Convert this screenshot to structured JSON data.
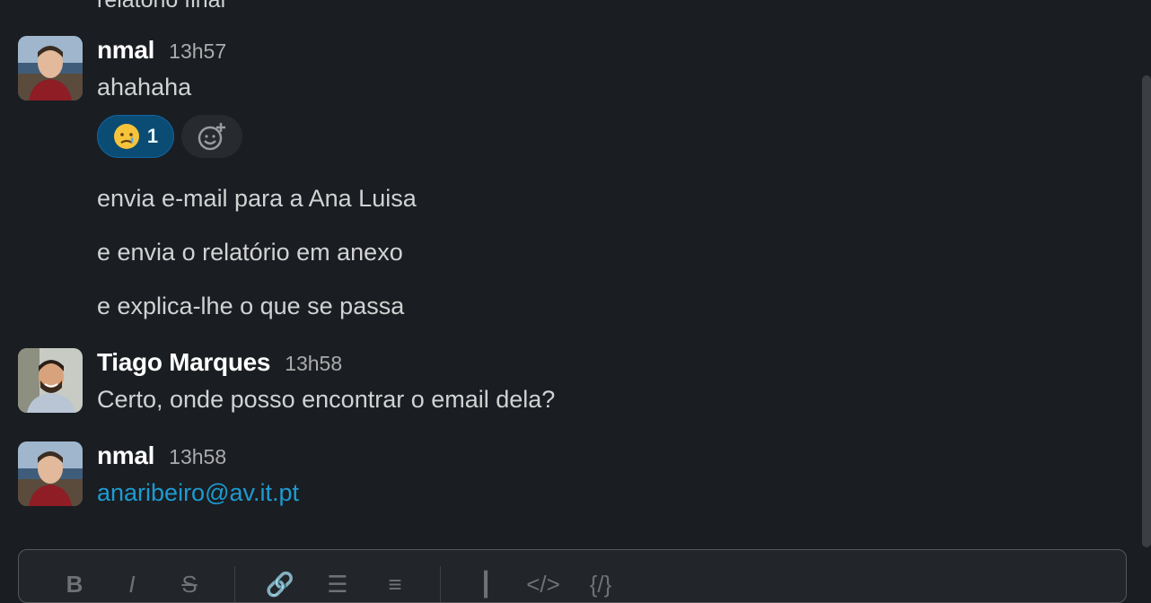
{
  "partial_message": {
    "text": "relatório final"
  },
  "messages": [
    {
      "author": "nmal",
      "time": "13h57",
      "lines": [
        "ahahaha",
        "envia e-mail para a Ana Luisa",
        "e envia o relatório em anexo",
        "e explica-lhe o que se passa"
      ],
      "reaction": {
        "emoji": "crying-face",
        "count": "1"
      }
    },
    {
      "author": "Tiago Marques",
      "time": "13h58",
      "lines": [
        "Certo, onde posso encontrar o email dela?"
      ]
    },
    {
      "author": "nmal",
      "time": "13h58",
      "link": "anaribeiro@av.it.pt"
    }
  ],
  "composer": {
    "toolbar": [
      "bold-icon",
      "italic-icon",
      "strikethrough-icon",
      "link-icon",
      "ordered-list-icon",
      "bulleted-list-icon",
      "blockquote-icon",
      "code-icon",
      "code-block-icon"
    ]
  },
  "colors": {
    "background": "#1a1d21",
    "link": "#1d9bd1",
    "reaction_bg": "#0b4c74"
  }
}
